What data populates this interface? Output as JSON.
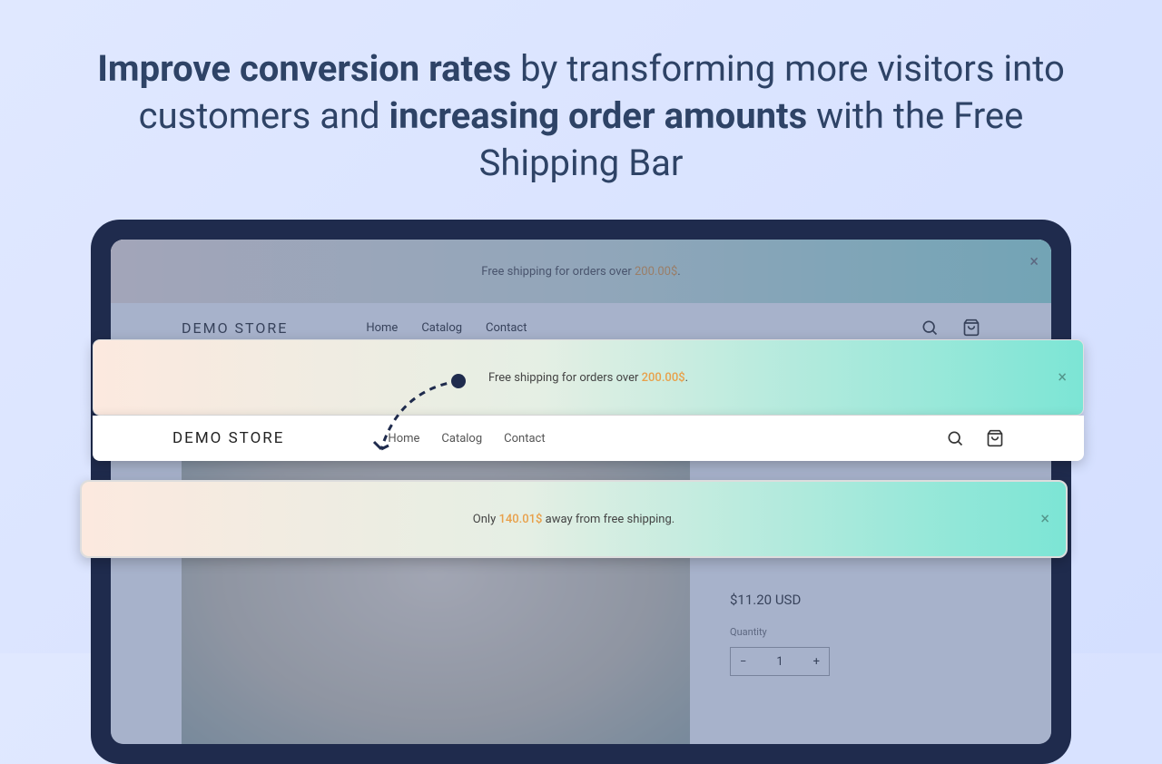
{
  "headline": {
    "bold1": "Improve conversion rates",
    "text1": " by transforming more visitors into customers and ",
    "bold2": "increasing order amounts",
    "text2": " with the Free Shipping Bar"
  },
  "bg_banner": {
    "prefix": "Free shipping for orders over ",
    "amount": "200.00$",
    "suffix": "."
  },
  "store_name": "DEMO STORE",
  "nav": {
    "home": "Home",
    "catalog": "Catalog",
    "contact": "Contact"
  },
  "product": {
    "price": "$11.20 USD",
    "qlabel": "Quantity",
    "qty": "1",
    "minus": "−",
    "plus": "+"
  },
  "overlay1": {
    "prefix": "Free shipping for orders over ",
    "amount": "200.00$",
    "suffix": "."
  },
  "overlay2": {
    "prefix": "Only ",
    "amount": "140.01$",
    "suffix": " away from free shipping."
  }
}
